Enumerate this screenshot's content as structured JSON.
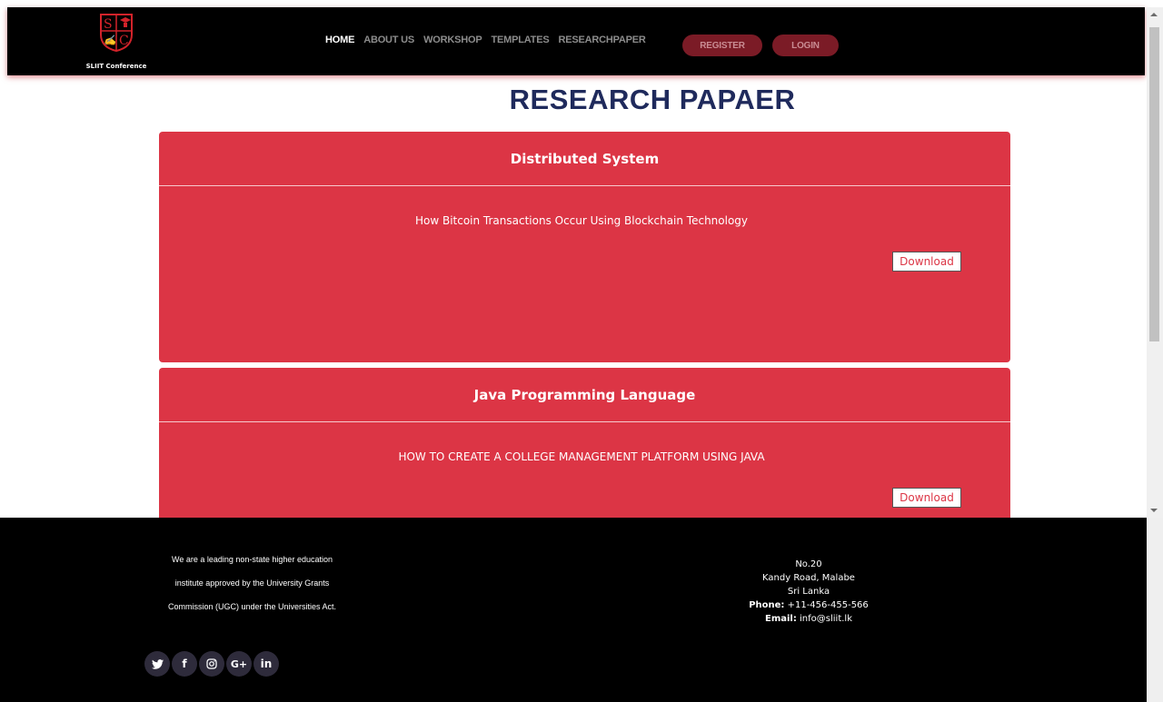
{
  "brand": {
    "name": "SLIIT Conference",
    "logo_letters": [
      "S",
      "C"
    ]
  },
  "nav": {
    "links": [
      {
        "label": "HOME",
        "active": true
      },
      {
        "label": "ABOUT US",
        "active": false
      },
      {
        "label": "WORKSHOP",
        "active": false
      },
      {
        "label": "TEMPLATES",
        "active": false
      },
      {
        "label": "RESEARCHPAPER",
        "active": false
      }
    ],
    "register_label": "REGISTER",
    "login_label": "LOGIN"
  },
  "page": {
    "title": "RESEARCH PAPAER"
  },
  "papers": [
    {
      "category": "Distributed System",
      "title": "How Bitcoin Transactions Occur Using Blockchain Technology",
      "download_label": "Download"
    },
    {
      "category": "Java Programming Language",
      "title": "HOW TO CREATE A COLLEGE MANAGEMENT PLATFORM USING JAVA",
      "download_label": "Download"
    }
  ],
  "footer": {
    "about_lines": [
      "We are a leading non-state higher education",
      "institute approved by the University Grants",
      "Commission (UGC) under the Universities Act."
    ],
    "address_lines": [
      "No.20",
      "Kandy Road, Malabe",
      "Sri Lanka"
    ],
    "phone_label": "Phone:",
    "phone": "+11-456-455-566",
    "email_label": "Email:",
    "email": "info@sliit.lk",
    "socials": [
      {
        "icon": "twitter-icon",
        "glyph": "🐦"
      },
      {
        "icon": "facebook-icon",
        "glyph": "f"
      },
      {
        "icon": "instagram-icon",
        "glyph": "◎"
      },
      {
        "icon": "google-plus-icon",
        "glyph": "G+"
      },
      {
        "icon": "linkedin-icon",
        "glyph": "in"
      }
    ]
  },
  "colors": {
    "accent": "#dc3545",
    "nav_button": "#7b1b26",
    "title": "#1f2a5c"
  }
}
